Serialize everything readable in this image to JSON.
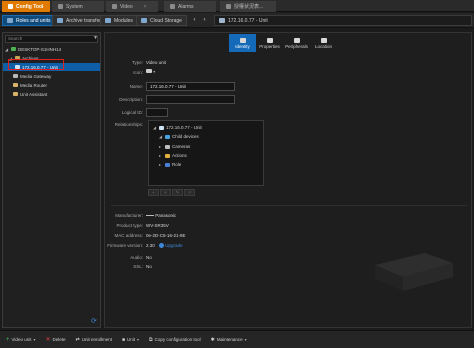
{
  "top_tabs": [
    {
      "label": "Config Tool",
      "active": true
    },
    {
      "label": "System"
    },
    {
      "label": "Video"
    },
    {
      "label": "Alarms"
    },
    {
      "label": "授權状況表..."
    }
  ],
  "sub_tabs": [
    {
      "label": "Roles and units",
      "active": true
    },
    {
      "label": "Archive transfer"
    },
    {
      "label": "Modules"
    },
    {
      "label": "Cloud Storage"
    }
  ],
  "breadcrumb": "172.16.0.77 - Unit",
  "search_placeholder": "Search",
  "tree": [
    {
      "label": "DESKTOP-S1HNH14"
    },
    {
      "label": "Archiver"
    },
    {
      "label": "172.16.0.77 - Unit",
      "selected": true
    },
    {
      "label": "Media Gateway"
    },
    {
      "label": "Media Router"
    },
    {
      "label": "Unit Assistant"
    }
  ],
  "right_tabs": [
    {
      "label": "Identity",
      "active": true
    },
    {
      "label": "Properties"
    },
    {
      "label": "Peripherals"
    },
    {
      "label": "Location"
    }
  ],
  "identity": {
    "type_label": "Type:",
    "type_value": "Video unit",
    "icon_label": "Icon:",
    "name_label": "Name:",
    "name_value": "172.16.0.77 - Unit",
    "description_label": "Description:",
    "logical_id_label": "Logical ID:",
    "relationships_label": "Relationships:"
  },
  "relationships": [
    {
      "label": "172.16.0.77 - Unit"
    },
    {
      "label": "Child devices"
    },
    {
      "label": "Cameras"
    },
    {
      "label": "Actions"
    },
    {
      "label": "Role"
    }
  ],
  "details": {
    "manufacturer_label": "Manufacturer:",
    "manufacturer_value": "Panasonic",
    "product_type_label": "Product type:",
    "product_type_value": "WV-SR35V",
    "mac_label": "MAC address:",
    "mac_value": "0e-2D-C5-16-21-8E",
    "firmware_label": "Firmware version:",
    "firmware_value": "2.30",
    "upgrade_label": "Upgrade",
    "audio_label": "Audio:",
    "audio_value": "No",
    "ssl_label": "SSL:",
    "ssl_value": "No"
  },
  "bottom_actions": [
    {
      "label": "Video unit"
    },
    {
      "label": "Delete"
    },
    {
      "label": "Unit enrollment"
    },
    {
      "label": "Unit"
    },
    {
      "label": "Copy configuration tool"
    },
    {
      "label": "Maintenance"
    }
  ],
  "colors": {
    "accent_orange": "#e07b00",
    "selection_blue": "#0f5fa8",
    "highlight_red": "#e02020"
  }
}
